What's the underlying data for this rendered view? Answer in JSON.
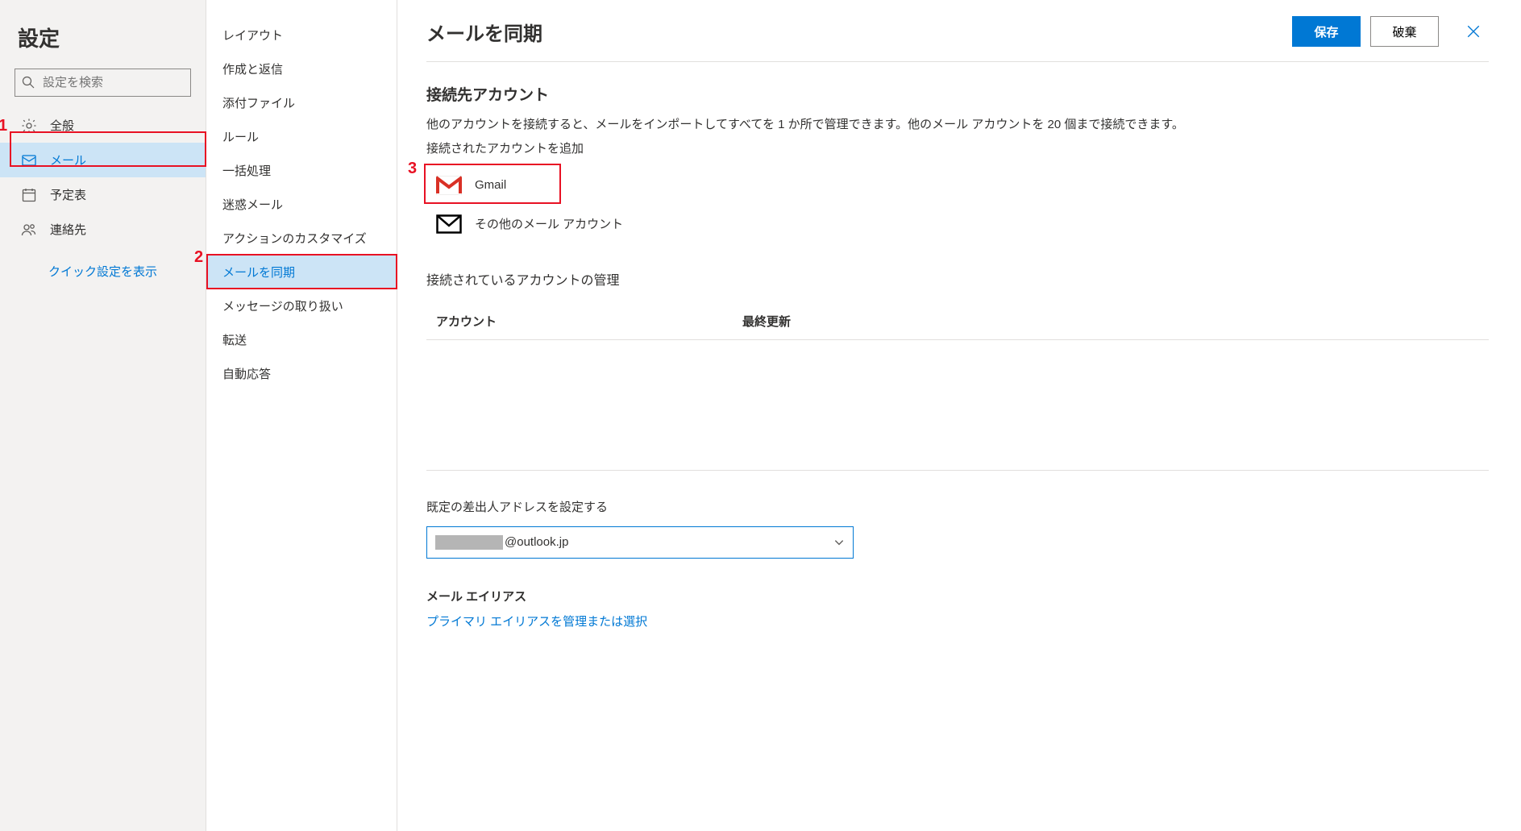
{
  "col1": {
    "title": "設定",
    "search_placeholder": "設定を検索",
    "items": [
      {
        "label": "全般",
        "icon": "gear"
      },
      {
        "label": "メール",
        "icon": "mail",
        "selected": true
      },
      {
        "label": "予定表",
        "icon": "calendar"
      },
      {
        "label": "連絡先",
        "icon": "people"
      }
    ],
    "quick_link": "クイック設定を表示"
  },
  "col2": {
    "items": [
      {
        "label": "レイアウト"
      },
      {
        "label": "作成と返信"
      },
      {
        "label": "添付ファイル"
      },
      {
        "label": "ルール"
      },
      {
        "label": "一括処理"
      },
      {
        "label": "迷惑メール"
      },
      {
        "label": "アクションのカスタマイズ"
      },
      {
        "label": "メールを同期",
        "selected": true
      },
      {
        "label": "メッセージの取り扱い"
      },
      {
        "label": "転送"
      },
      {
        "label": "自動応答"
      }
    ]
  },
  "main": {
    "title": "メールを同期",
    "save": "保存",
    "discard": "破棄",
    "connected": {
      "heading": "接続先アカウント",
      "desc": "他のアカウントを接続すると、メールをインポートしてすべてを 1 か所で管理できます。他のメール アカウントを 20 個まで接続できます。",
      "add_label": "接続されたアカウントを追加",
      "providers": [
        {
          "name": "Gmail",
          "icon": "gmail"
        },
        {
          "name": "その他のメール アカウント",
          "icon": "envelope"
        }
      ]
    },
    "manage": {
      "heading": "接続されているアカウントの管理",
      "col_account": "アカウント",
      "col_updated": "最終更新"
    },
    "default_from": {
      "heading": "既定の差出人アドレスを設定する",
      "value_suffix": "@outlook.jp"
    },
    "alias": {
      "heading": "メール エイリアス",
      "link": "プライマリ エイリアスを管理または選択"
    }
  },
  "annotations": {
    "n1": "1",
    "n2": "2",
    "n3": "3"
  }
}
